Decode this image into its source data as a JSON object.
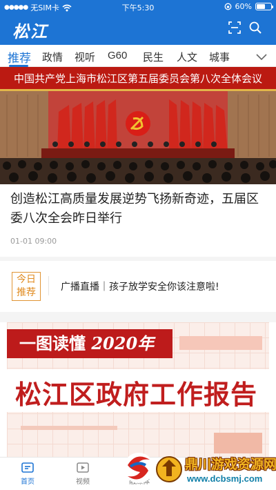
{
  "status_bar": {
    "carrier": "无SIM卡",
    "time": "下午5:30",
    "battery": "60%",
    "battery_level": 0.6
  },
  "header": {
    "logo": "松江",
    "scan_icon": "scan-icon",
    "search_icon": "search-icon"
  },
  "tabs": [
    {
      "label": "推荐",
      "active": true
    },
    {
      "label": "政情"
    },
    {
      "label": "视听"
    },
    {
      "label": "G60"
    },
    {
      "label": "民生"
    },
    {
      "label": "人文"
    },
    {
      "label": "城事"
    }
  ],
  "hero": {
    "banner": "中国共产党上海市松江区第五届委员会第八次全体会议"
  },
  "headline": {
    "title": "创造松江高质量发展逆势飞扬新奇迹，五届区委八次全会昨日举行",
    "time": "01-01 09:00"
  },
  "recommend": {
    "badge_top": "今日",
    "badge_bottom": "推荐",
    "text": "广播直播｜孩子放学安全你该注意啦!"
  },
  "report_card": {
    "subtitle_prefix": "一图读懂",
    "subtitle_year": "2020年",
    "title": "松江区政府工作报告"
  },
  "bottom_nav": [
    {
      "label": "首页",
      "icon": "home-icon",
      "active": true
    },
    {
      "label": "视频",
      "icon": "video-icon"
    },
    {
      "label": "融媒体",
      "icon": "media-icon"
    }
  ],
  "watermark": {
    "name": "鼎川游戏资源网",
    "url": "www.dcbsmj.com"
  },
  "colors": {
    "brand": "#1d74d4",
    "banner_red": "#bb1a12",
    "accent_orange": "#e08a1e"
  }
}
